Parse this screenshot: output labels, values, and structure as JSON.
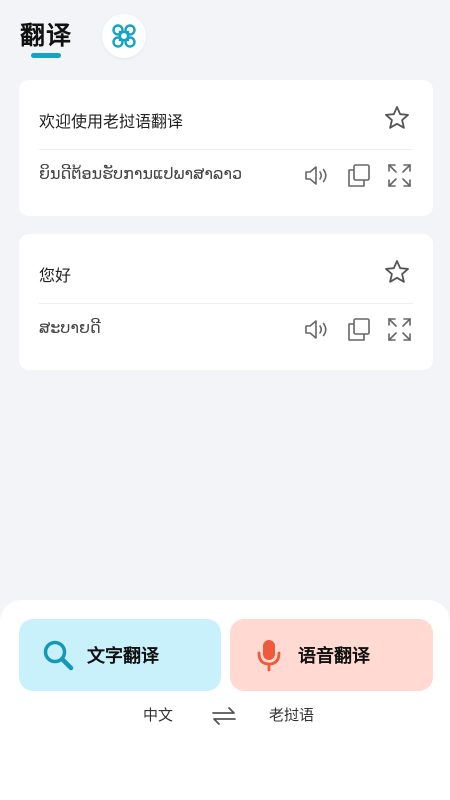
{
  "header": {
    "title": "翻译"
  },
  "cards": [
    {
      "source": "欢迎使用老挝语翻译",
      "translation": "ຍິນດີຕ້ອນຮັບການແປພາສາລາວ"
    },
    {
      "source": "您好",
      "translation": "ສະບາຍດີ"
    }
  ],
  "modes": {
    "text_label": "文字翻译",
    "voice_label": "语音翻译"
  },
  "languages": {
    "source": "中文",
    "target": "老挝语"
  },
  "icons": [
    "command-icon",
    "star-icon",
    "speaker-icon",
    "copy-icon",
    "expand-icon",
    "search-icon",
    "microphone-icon",
    "swap-icon"
  ],
  "colors": {
    "accent": "#14a3c7",
    "text_mode_bg": "#c9f1fb",
    "voice_mode_bg": "#ffd9d2",
    "mic": "#f05a3c"
  }
}
